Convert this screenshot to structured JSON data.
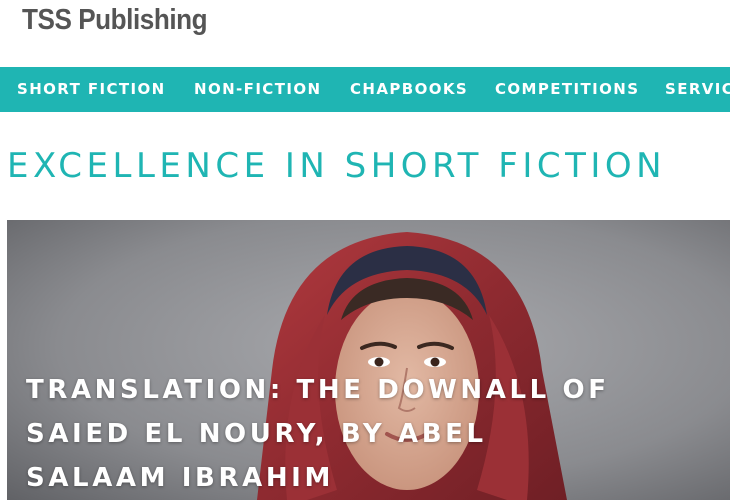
{
  "site": {
    "brand": "TSS Publishing"
  },
  "nav": {
    "items": [
      {
        "label": "SHORT FICTION"
      },
      {
        "label": "NON-FICTION"
      },
      {
        "label": "CHAPBOOKS"
      },
      {
        "label": "COMPETITIONS"
      },
      {
        "label": "SERVIC"
      }
    ]
  },
  "main": {
    "heading": "EXCELLENCE IN SHORT FICTION"
  },
  "feature": {
    "title": "TRANSLATION: THE DOWNALL OF SAIED EL NOURY, BY ABEL SALAAM IBRAHIM"
  },
  "colors": {
    "accent": "#1fb5b3",
    "brand_text": "#555555",
    "nav_text": "#ffffff"
  }
}
